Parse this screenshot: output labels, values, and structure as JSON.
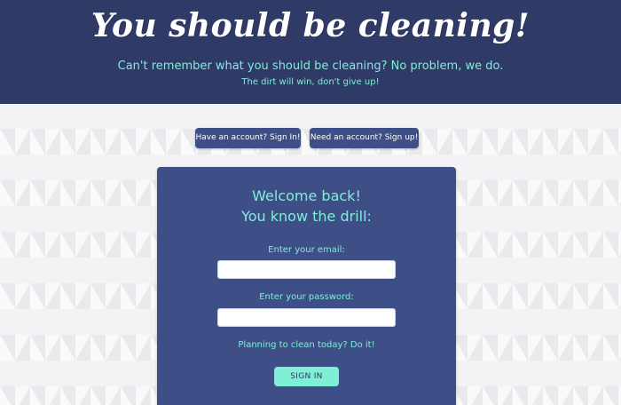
{
  "header": {
    "title": "You should be cleaning!",
    "tagline": "Can't remember what you should be cleaning? No problem, we do.",
    "subtagline": "The dirt will win, don't give up!"
  },
  "nav": {
    "signin_label": "Have an account? Sign In!",
    "signup_label": "Need an account? Sign up!"
  },
  "login_form": {
    "heading_line1": "Welcome back!",
    "heading_line2": "You know the drill:",
    "email_label": "Enter your email:",
    "email_value": "",
    "password_label": "Enter your password:",
    "password_value": "",
    "motivation": "Planning to clean today? Do it!",
    "submit_label": "SIGN IN"
  },
  "colors": {
    "header_bg": "#2f3a66",
    "card_bg": "#3d4f86",
    "accent": "#7ff0d6",
    "page_bg": "#f3f3f5"
  }
}
